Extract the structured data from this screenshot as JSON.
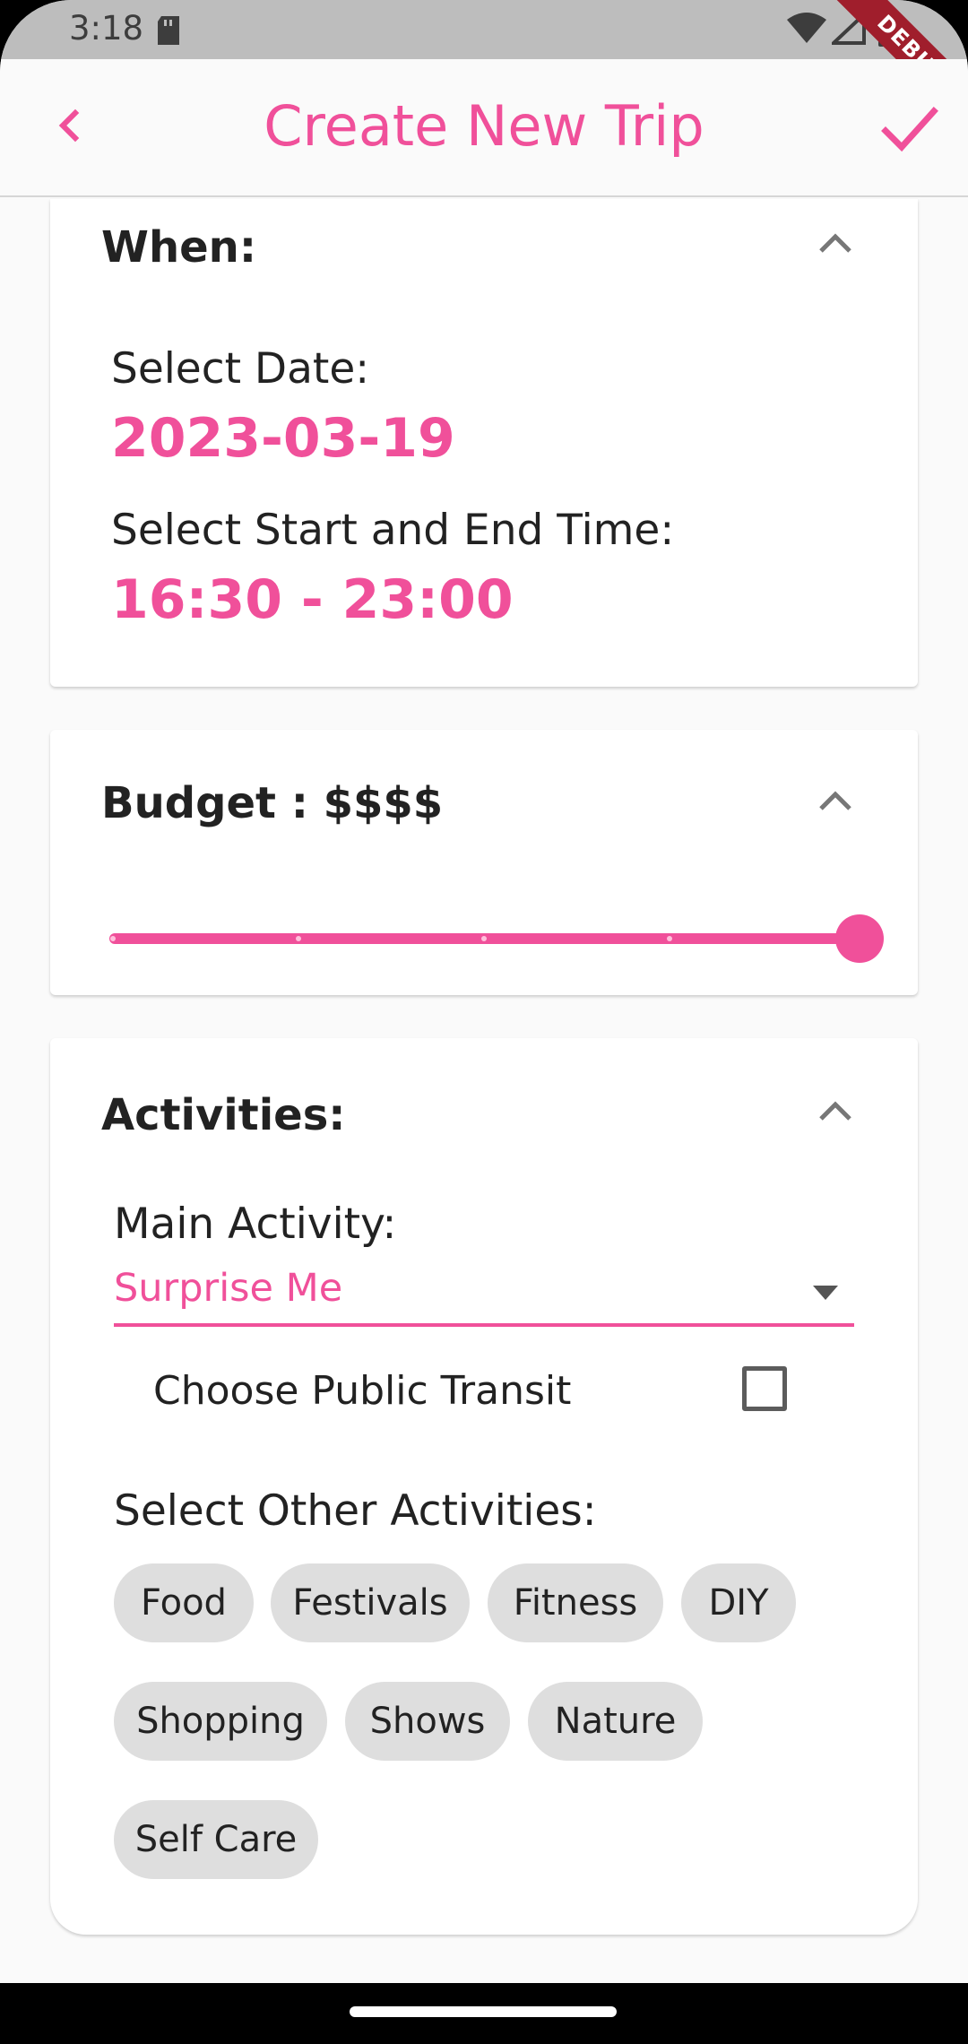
{
  "status_bar": {
    "time": "3:18",
    "debug_label": "DEBUG"
  },
  "app_bar": {
    "title": "Create New Trip",
    "back_icon": "chevron-left-icon",
    "confirm_icon": "check-icon"
  },
  "when_card": {
    "title": "When:",
    "date_label": "Select Date:",
    "date_value": "2023-03-19",
    "time_label": "Select Start and End Time:",
    "time_value": "16:30 - 23:00"
  },
  "budget_card": {
    "title": "Budget : $$$$",
    "slider_level": 4,
    "slider_max": 4
  },
  "activities_card": {
    "title": "Activities:",
    "main_activity_label": "Main Activity:",
    "main_activity_value": "Surprise Me",
    "public_transit_label": "Choose Public Transit",
    "public_transit_checked": false,
    "other_activities_label": "Select Other Activities:",
    "chips": [
      "Food",
      "Festivals",
      "Fitness",
      "DIY",
      "Shopping",
      "Shows",
      "Nature",
      "Self Care"
    ]
  },
  "colors": {
    "accent": "#f0509a",
    "chip_bg": "#dedede"
  }
}
